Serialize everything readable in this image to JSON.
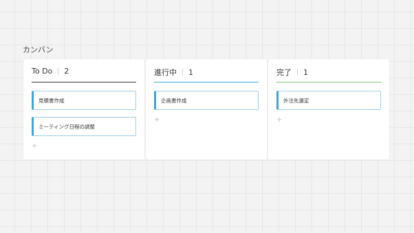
{
  "board": {
    "title": "カンバン"
  },
  "columns": [
    {
      "title": "To Do",
      "count": "2",
      "rule_color": "#333333",
      "cards": [
        "見積書作成",
        "ミーティング日程の調整"
      ],
      "add_label": "+"
    },
    {
      "title": "進行中",
      "count": "1",
      "rule_color": "#3fa3d8",
      "cards": [
        "企画書作成"
      ],
      "add_label": "+"
    },
    {
      "title": "完了",
      "count": "1",
      "rule_color": "#7cc47a",
      "cards": [
        "外注先選定"
      ],
      "add_label": "+"
    }
  ],
  "colors": {
    "card_accent": "#3fa3d8",
    "card_border": "#9ecbe6",
    "background": "#f3f3f3"
  }
}
